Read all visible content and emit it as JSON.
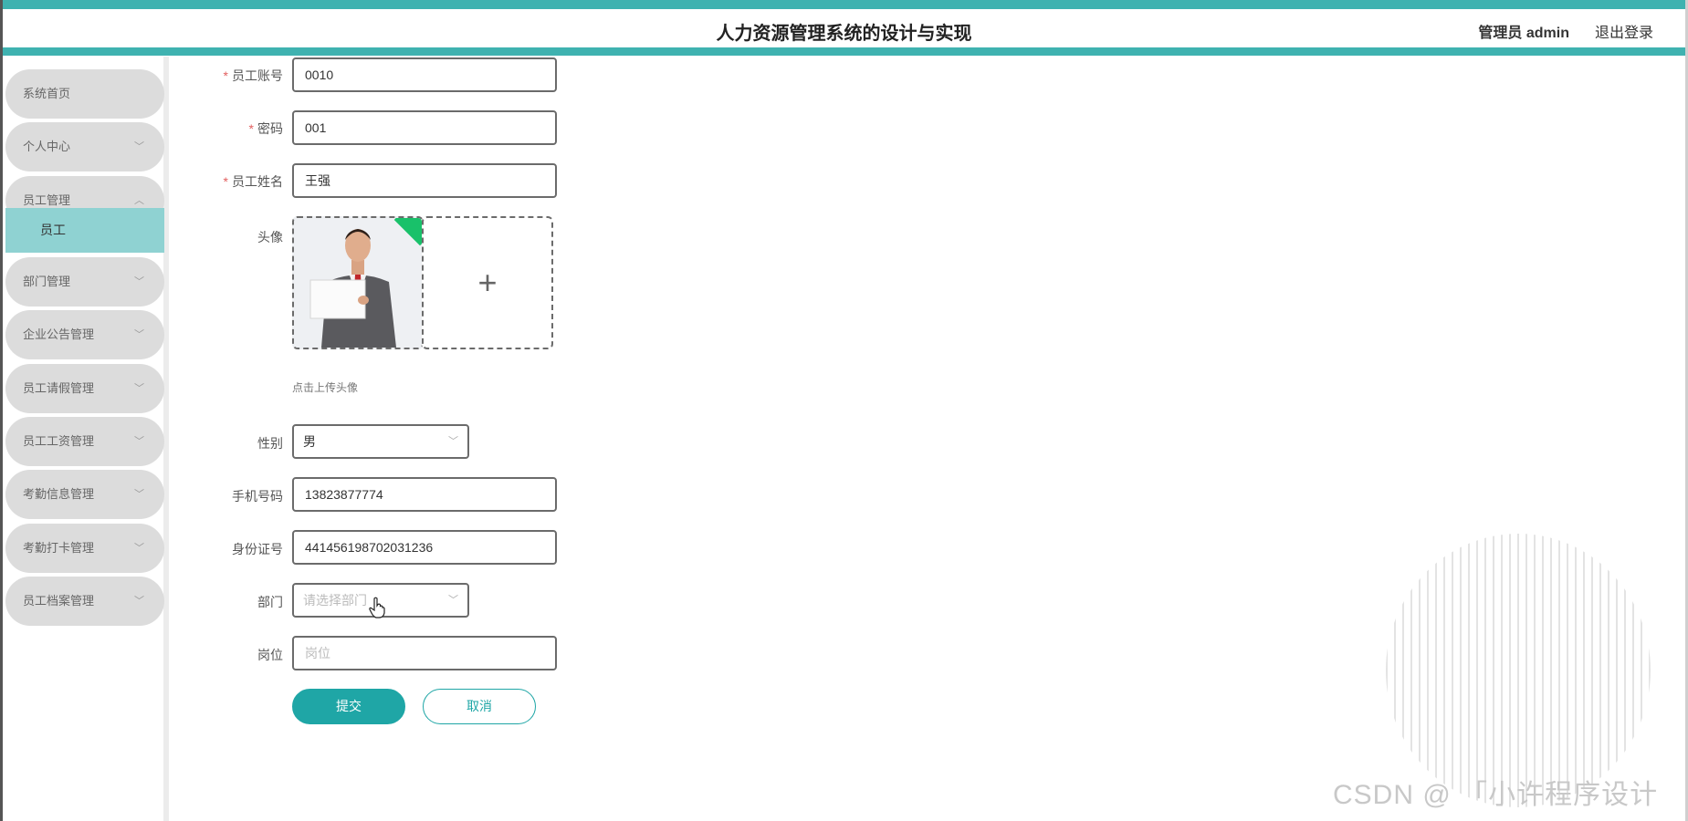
{
  "header": {
    "title": "人力资源管理系统的设计与实现",
    "user_label": "管理员 admin",
    "logout_label": "退出登录"
  },
  "sidebar": {
    "items": [
      {
        "label": "系统首页",
        "chevron": ""
      },
      {
        "label": "个人中心",
        "chevron": "﹀"
      },
      {
        "label": "员工管理",
        "chevron": "︿"
      },
      {
        "label": "部门管理",
        "chevron": "﹀"
      },
      {
        "label": "企业公告管理",
        "chevron": "﹀"
      },
      {
        "label": "员工请假管理",
        "chevron": "﹀"
      },
      {
        "label": "员工工资管理",
        "chevron": "﹀"
      },
      {
        "label": "考勤信息管理",
        "chevron": "﹀"
      },
      {
        "label": "考勤打卡管理",
        "chevron": "﹀"
      },
      {
        "label": "员工档案管理",
        "chevron": "﹀"
      }
    ],
    "subitem": {
      "label": "员工"
    }
  },
  "form": {
    "account": {
      "label": "员工账号",
      "value": "0010",
      "required": "*"
    },
    "password": {
      "label": "密码",
      "value": "001",
      "required": "*"
    },
    "name": {
      "label": "员工姓名",
      "value": "王强",
      "required": "*"
    },
    "avatar": {
      "label": "头像",
      "hint": "点击上传头像",
      "add_symbol": "+"
    },
    "gender": {
      "label": "性别",
      "value": "男"
    },
    "phone": {
      "label": "手机号码",
      "value": "13823877774"
    },
    "id_card": {
      "label": "身份证号",
      "value": "441456198702031236"
    },
    "department": {
      "label": "部门",
      "placeholder": "请选择部门"
    },
    "position": {
      "label": "岗位",
      "placeholder": "岗位"
    },
    "submit_label": "提交",
    "cancel_label": "取消"
  },
  "watermark": "CSDN @ 「小许程序设计",
  "colors": {
    "accent": "#3fb2b0",
    "button": "#1fa6a6",
    "submenu_active": "#8fd2d2",
    "required": "#e25f5f"
  }
}
